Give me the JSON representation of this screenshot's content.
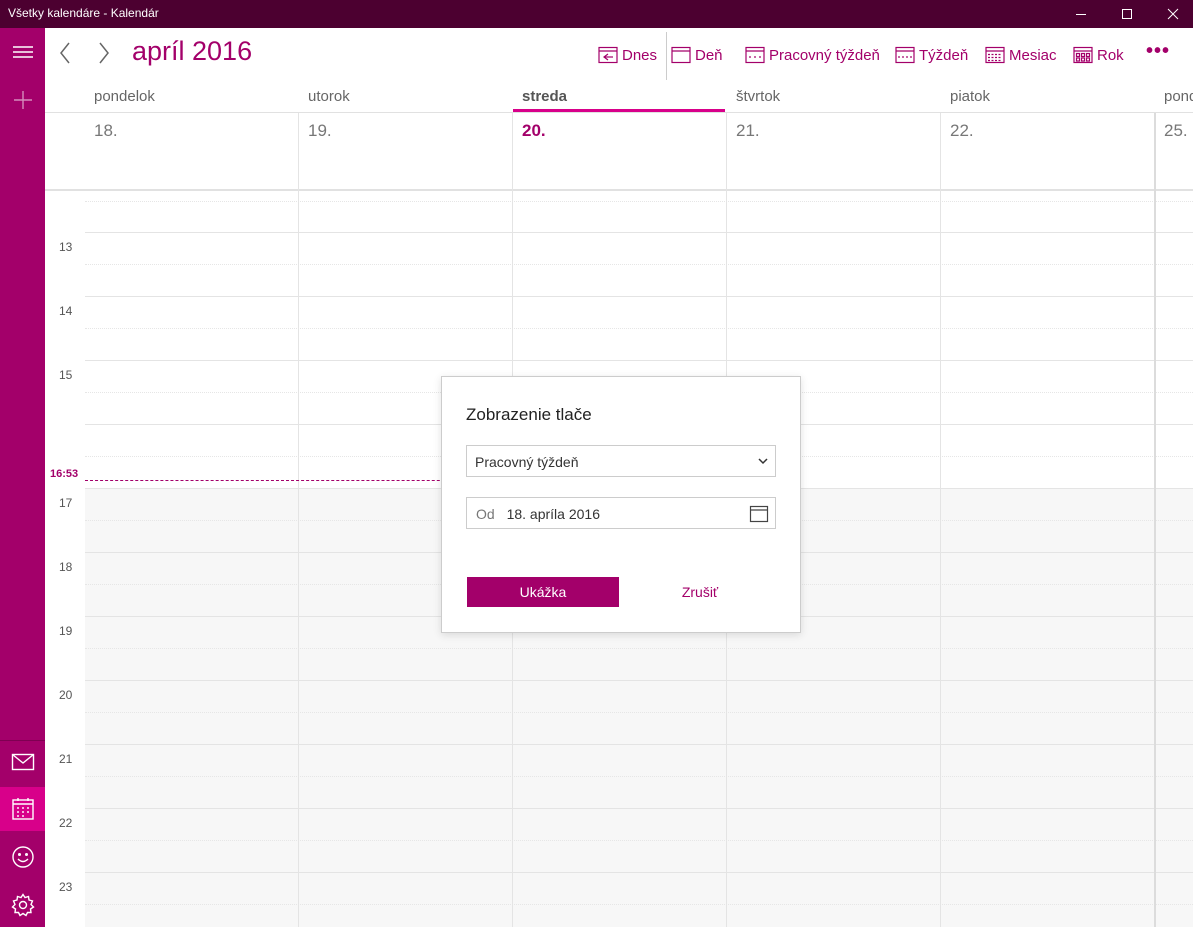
{
  "window": {
    "title": "Všetky kalendáre - Kalendár"
  },
  "header": {
    "month_title": "apríl 2016",
    "toolbar": {
      "today": "Dnes",
      "day": "Deň",
      "work_week": "Pracovný týždeň",
      "week": "Týždeň",
      "month": "Mesiac",
      "year": "Rok",
      "more": "•••"
    }
  },
  "days": [
    {
      "name": "pondelok",
      "date": "18."
    },
    {
      "name": "utorok",
      "date": "19."
    },
    {
      "name": "streda",
      "date": "20.",
      "today": true
    },
    {
      "name": "štvrtok",
      "date": "21."
    },
    {
      "name": "piatok",
      "date": "22."
    },
    {
      "name": "pond",
      "date": "25."
    }
  ],
  "hours": [
    "13",
    "14",
    "15",
    "17",
    "18",
    "19",
    "20",
    "21",
    "22",
    "23"
  ],
  "now": "16:53",
  "dialog": {
    "title": "Zobrazenie tlače",
    "view_select": "Pracovný týždeň",
    "from_label": "Od",
    "from_date": "18. apríla 2016",
    "preview_button": "Ukážka",
    "cancel_button": "Zrušiť"
  },
  "icons": [
    "hamburger-icon",
    "plus-icon",
    "mail-icon",
    "calendar-icon",
    "smiley-icon",
    "gear-icon"
  ],
  "colors": {
    "accent": "#a3006a",
    "titlebar": "#4c0030",
    "active_rail": "#d8008a"
  }
}
